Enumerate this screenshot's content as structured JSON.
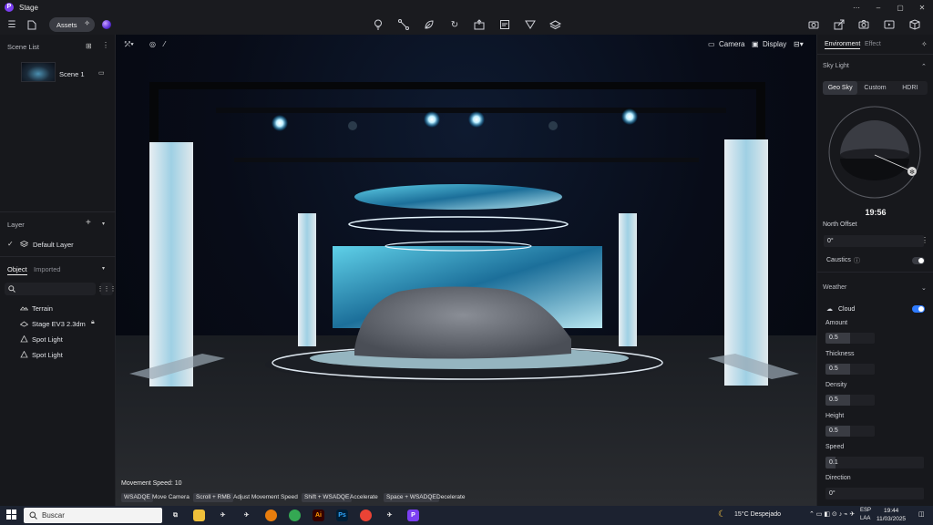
{
  "app": {
    "title": "Stage",
    "icon_letter": "P",
    "accent": "#7b3ff2"
  },
  "window": {
    "minimize": "–",
    "maximize": "▢",
    "close": "✕"
  },
  "toolbar": {
    "assets_label": "Assets",
    "left_icons": [
      "menu-icon",
      "new-file-icon"
    ],
    "center_icons": [
      "light-bulb-icon",
      "path-icon",
      "leaf-icon",
      "refresh-icon",
      "export-icon",
      "stamp-icon",
      "paint-icon",
      "layers-icon"
    ],
    "right_icons": [
      "camera-rig-icon",
      "share-icon",
      "photo-icon",
      "video-icon",
      "cube-icon"
    ]
  },
  "scene_list": {
    "title": "Scene List",
    "scenes": [
      {
        "name": "Scene 1"
      }
    ]
  },
  "layer": {
    "title": "Layer",
    "items": [
      {
        "name": "Default Layer"
      }
    ]
  },
  "objects": {
    "tabs": [
      "Object",
      "Imported"
    ],
    "active_tab": "Object",
    "items": [
      {
        "name": "Terrain",
        "icon": "terrain-icon"
      },
      {
        "name": "Stage EV3 2.3dm",
        "icon": "model-icon",
        "locked": true
      },
      {
        "name": "Spot Light",
        "icon": "spot-light-icon"
      },
      {
        "name": "Spot Light",
        "icon": "spot-light-icon"
      }
    ]
  },
  "viewport": {
    "camera_label": "Camera",
    "display_label": "Display",
    "movement_speed": "Movement Speed: 10",
    "hints": [
      {
        "key": "WSADQE",
        "text": "Move Camera"
      },
      {
        "key": "Scroll + RMB",
        "text": "Adjust Movement Speed"
      },
      {
        "key": "Shift + WSADQE",
        "text": "Accelerate"
      },
      {
        "key": "Space + WSADQE",
        "text": "Decelerate"
      }
    ]
  },
  "right_panel": {
    "tabs": [
      "Environment",
      "Effect"
    ],
    "active_tab": "Environment",
    "sky_light": {
      "title": "Sky Light",
      "modes": [
        "Geo Sky",
        "Custom",
        "HDRI"
      ],
      "active_mode": "Geo Sky",
      "time": "19:56",
      "north_offset_label": "North Offset",
      "north_offset": "0°",
      "caustics_label": "Caustics",
      "caustics_on": false
    },
    "weather": {
      "title": "Weather",
      "cloud_label": "Cloud",
      "cloud_on": true,
      "params": [
        {
          "label": "Amount",
          "value": "0.5",
          "fill": 0.5
        },
        {
          "label": "Thickness",
          "value": "0.5",
          "fill": 0.5
        },
        {
          "label": "Density",
          "value": "0.5",
          "fill": 0.5
        },
        {
          "label": "Height",
          "value": "0.5",
          "fill": 0.5
        },
        {
          "label": "Speed",
          "value": "0.1",
          "fill": 0.1
        },
        {
          "label": "Direction",
          "value": "0°",
          "fill": 0.0
        }
      ]
    }
  },
  "taskbar": {
    "search_placeholder": "Buscar",
    "weather": "15°C  Despejado",
    "lang_top": "ESP",
    "lang_bottom": "LAA",
    "time": "19:44",
    "date": "11/03/2025"
  }
}
